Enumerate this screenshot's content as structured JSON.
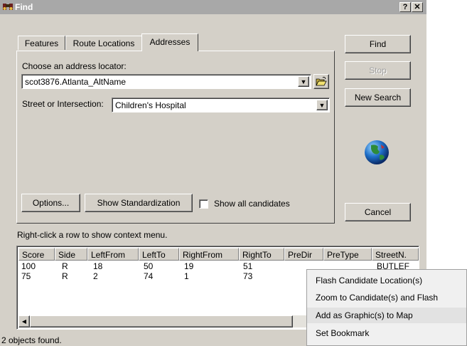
{
  "window": {
    "title": "Find",
    "help_label": "?",
    "close_label": "✕"
  },
  "tabs": [
    {
      "label": "Features"
    },
    {
      "label": "Route Locations"
    },
    {
      "label": "Addresses"
    }
  ],
  "locator": {
    "label": "Choose an address locator:",
    "value": "scot3876.Atlanta_AltName"
  },
  "street": {
    "label": "Street or Intersection:",
    "value": "Children's Hospital"
  },
  "buttons": {
    "find": "Find",
    "stop": "Stop",
    "new_search": "New Search",
    "cancel": "Cancel",
    "options": "Options...",
    "show_standardization": "Show Standardization"
  },
  "show_all_candidates": {
    "label": "Show all candidates",
    "checked": false
  },
  "hint": "Right-click a row to show context menu.",
  "table": {
    "headers": [
      "Score",
      "Side",
      "LeftFrom",
      "LeftTo",
      "RightFrom",
      "RightTo",
      "PreDir",
      "PreType",
      "StreetN."
    ],
    "rows": [
      [
        "100",
        "R",
        "18",
        "50",
        "19",
        "51",
        "",
        "",
        "BUTLEF"
      ],
      [
        "75",
        "R",
        "2",
        "74",
        "1",
        "73",
        "",
        "",
        ""
      ]
    ]
  },
  "status": "2 objects found.",
  "context_menu": {
    "items": [
      {
        "label": "Flash Candidate Location(s)"
      },
      {
        "label": "Zoom to Candidate(s) and Flash"
      },
      {
        "label": "Add as Graphic(s) to Map"
      },
      {
        "label": "Set Bookmark"
      }
    ]
  },
  "colors": {
    "dialog_bg": "#d4d0c8",
    "titlebar": "#a8a8a8",
    "menu_bg": "#f0f0f0",
    "menu_hover": "#e2e2e2"
  },
  "icons": {
    "title": "binoculars-icon",
    "open_folder": "open-folder-icon",
    "globe": "globe-icon",
    "dropdown": "dropdown-arrow-icon",
    "scroll_left": "scroll-left-arrow-icon"
  }
}
